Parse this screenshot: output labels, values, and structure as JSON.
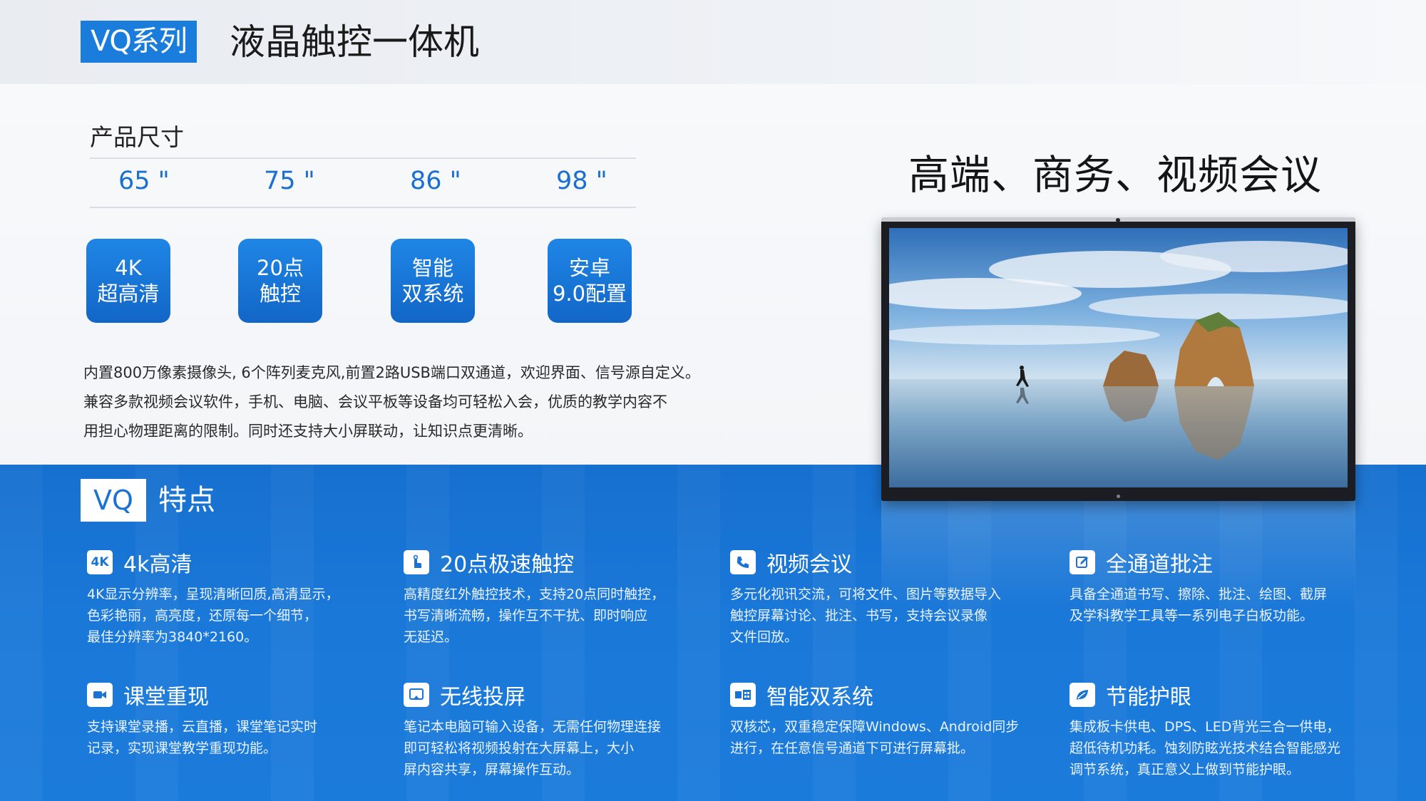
{
  "header": {
    "series_tag": "VQ系列",
    "title": "液晶触控一体机"
  },
  "sizes": {
    "label": "产品尺寸",
    "items": [
      "65 \"",
      "75 \"",
      "86 \"",
      "98 \""
    ]
  },
  "pills": [
    {
      "line1": "4K",
      "line2": "超高清"
    },
    {
      "line1": "20点",
      "line2": "触控"
    },
    {
      "line1": "智能",
      "line2": "双系统"
    },
    {
      "line1": "安卓",
      "line2": "9.0配置"
    }
  ],
  "description": [
    "内置800万像素摄像头, 6个阵列麦克风,前置2路USB端口双通道，欢迎界面、信号源自定义。",
    "兼容多款视频会议软件，手机、电脑、会议平板等设备均可轻松入会，优质的教学内容不",
    "用担心物理距离的限制。同时还支持大小屏联动，让知识点更清晰。"
  ],
  "slogan": "高端、商务、视频会议",
  "features_header": {
    "badge": "VQ",
    "title": "特点"
  },
  "features": [
    {
      "icon": "4k-icon",
      "icon_text": "4K",
      "title": "4k高清",
      "lines": [
        "4K显示分辨率，呈现清晰回质,高清显示，",
        "色彩艳丽，高亮度，还原每一个细节，",
        "最佳分辨率为3840*2160。"
      ]
    },
    {
      "icon": "touch-icon",
      "icon_text": "",
      "title": "20点极速触控",
      "lines": [
        "高精度红外触控技术，支持20点同时触控，",
        "书写清晰流畅，操作互不干扰、即时响应",
        "无延迟。"
      ]
    },
    {
      "icon": "phone-icon",
      "icon_text": "",
      "title": "视频会议",
      "lines": [
        "多元化视讯交流，可将文件、图片等数据导入",
        "触控屏幕讨论、批注、书写，支持会议录像",
        "文件回放。"
      ]
    },
    {
      "icon": "annotate-icon",
      "icon_text": "",
      "title": "全通道批注",
      "lines": [
        "具备全通道书写、擦除、批注、绘图、截屏",
        "及学科教学工具等一系列电子白板功能。"
      ]
    },
    {
      "icon": "camera-icon",
      "icon_text": "",
      "title": "课堂重现",
      "lines": [
        "支持课堂录播，云直播，课堂笔记实时",
        "记录，实现课堂教学重现功能。"
      ]
    },
    {
      "icon": "cast-icon",
      "icon_text": "",
      "title": "无线投屏",
      "lines": [
        "笔记本电脑可输入设备，无需任何物理连接",
        "即可轻松将视频投射在大屏幕上，大小",
        "屏内容共享，屏幕操作互动。"
      ]
    },
    {
      "icon": "dual-system-icon",
      "icon_text": "",
      "title": "智能双系统",
      "lines": [
        "双核芯，双重稳定保障Windows、Android同步",
        "进行，在任意信号通道下可进行屏幕批。"
      ]
    },
    {
      "icon": "leaf-icon",
      "icon_text": "",
      "title": "节能护眼",
      "lines": [
        "集成板卡供电、DPS、LED背光三合一供电，",
        "超低待机功耗。蚀刻防眩光技术结合智能感光",
        "调节系统，真正意义上做到节能护眼。"
      ]
    }
  ]
}
